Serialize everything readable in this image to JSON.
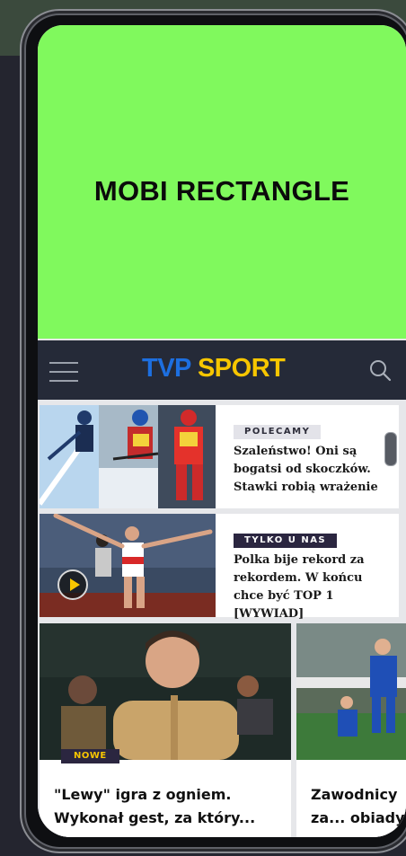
{
  "ad": {
    "label": "MOBI RECTANGLE"
  },
  "nav": {
    "logo_tvp": "TVP",
    "logo_sport": "SPORT"
  },
  "colors": {
    "ad_bg": "#80f95d",
    "nav_bg": "#252a38",
    "logo_blue": "#1d6fe0",
    "logo_yellow": "#f7c600",
    "badge_dark": "#2b2640"
  },
  "icons": {
    "menu": "hamburger-icon",
    "search": "search-icon",
    "play": "play-icon",
    "scroll": "scroll-indicator-icon"
  },
  "articles": [
    {
      "badge": "POLECAMY",
      "title": "Szaleństwo! Oni są bogatsi od skoczków. Stawki robią wrażenie"
    },
    {
      "badge": "TYLKO U NAS",
      "title": "Polka bije rekord za rekordem. W końcu chce być TOP 1 [WYWIAD]"
    }
  ],
  "featured": [
    {
      "badge": "NOWE",
      "title": "\"Lewy\" igra z ogniem. Wykonał gest, za który..."
    },
    {
      "title": "Zawodnicy za... obiady"
    }
  ]
}
